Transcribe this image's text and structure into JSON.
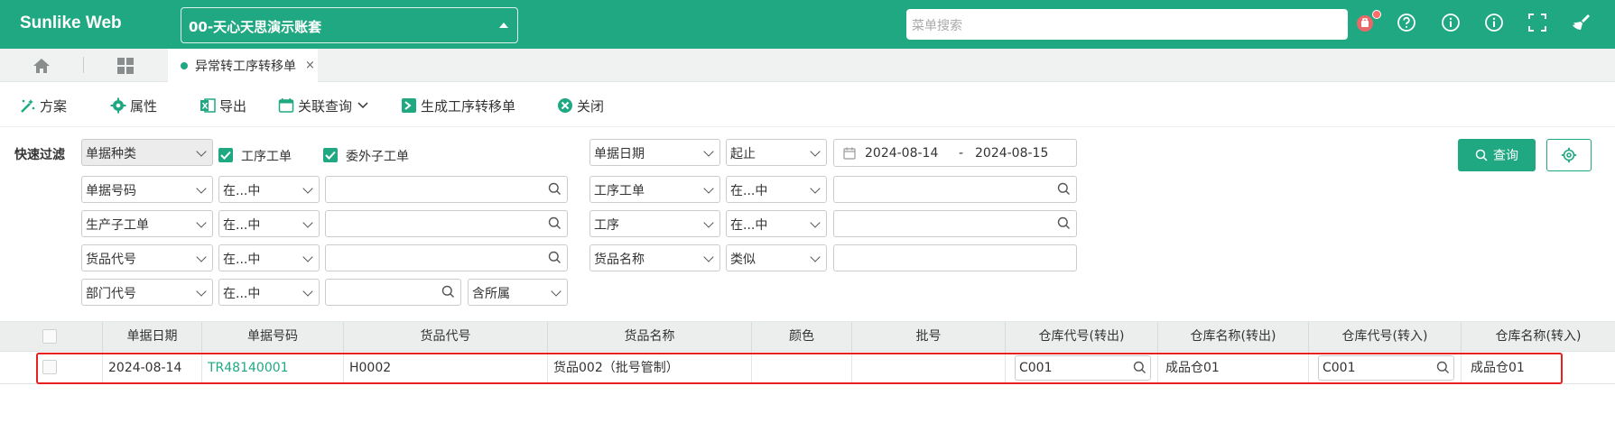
{
  "app": {
    "brand": "Sunlike Web",
    "account": "00-天心天思演示账套",
    "search_placeholder": "菜单搜索"
  },
  "colors": {
    "accent": "#20a882",
    "highlight": "#e8201f",
    "badge": "#ff6a6a"
  },
  "header_icons": [
    "app-icon",
    "help-icon",
    "info-icon",
    "info-icon",
    "fullscreen-icon",
    "broom-icon"
  ],
  "tabs": {
    "active": "异常转工序转移单",
    "close": "×"
  },
  "toolbar": {
    "scheme": "方案",
    "properties": "属性",
    "export": "导出",
    "related_query": "关联查询",
    "generate": "生成工序转移单",
    "close": "关闭"
  },
  "filter": {
    "label": "快速过滤",
    "doc_type": "单据种类",
    "chk_process_order": "工序工单",
    "chk_outsource": "委外子工单",
    "doc_date": "单据日期",
    "date_mode": "起止",
    "date_from": "2024-08-14",
    "date_sep": "-",
    "date_to": "2024-08-15",
    "query": "查询",
    "rows": [
      {
        "field": "单据号码",
        "op": "在...中"
      },
      {
        "field": "生产子工单",
        "op": "在...中"
      },
      {
        "field": "货品代号",
        "op": "在...中"
      },
      {
        "field": "部门代号",
        "op": "在...中",
        "extra": "含所属"
      }
    ],
    "right_rows": [
      {
        "field": "工序工单",
        "op": "在...中"
      },
      {
        "field": "工序",
        "op": "在...中"
      },
      {
        "field": "货品名称",
        "op": "类似"
      }
    ]
  },
  "grid": {
    "columns": [
      "单据日期",
      "单据号码",
      "货品代号",
      "货品名称",
      "颜色",
      "批号",
      "仓库代号(转出)",
      "仓库名称(转出)",
      "仓库代号(转入)",
      "仓库名称(转入)"
    ],
    "rows": [
      {
        "date": "2024-08-14",
        "doc_no": "TR48140001",
        "item_code": "H0002",
        "item_name": "货品002（批号管制）",
        "color": "",
        "batch": "",
        "wh_out_code": "C001",
        "wh_out_name": "成品仓01",
        "wh_in_code": "C001",
        "wh_in_name": "成品仓01"
      }
    ]
  }
}
